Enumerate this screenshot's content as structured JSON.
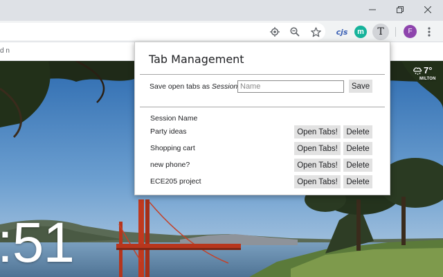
{
  "window": {
    "controls": {
      "minimize_icon": "minimize-icon",
      "restore_icon": "restore-icon",
      "close_icon": "close-icon"
    }
  },
  "toolbar": {
    "icons": [
      "location-icon",
      "zoom-out-icon",
      "bookmark-star-icon",
      "menu-dots-icon"
    ],
    "extensions": {
      "cjs_label": "cjs",
      "m_label": "m",
      "tab_manager_label": "T"
    },
    "profile_initial": "F",
    "bookmark_fragment": "d n"
  },
  "background": {
    "clock_text": ":51",
    "weather": {
      "icon": "cloud-snow-icon",
      "temperature": "7°",
      "location": "MILTON"
    }
  },
  "popup": {
    "title": "Tab Management",
    "save_label_prefix": "Save open tabs as ",
    "save_label_emphasis": "Session",
    "name_placeholder": "Name",
    "save_button": "Save",
    "column_header": "Session Name",
    "sessions": [
      {
        "name": "Party ideas",
        "open_label": "Open Tabs!",
        "delete_label": "Delete"
      },
      {
        "name": "Shopping cart",
        "open_label": "Open Tabs!",
        "delete_label": "Delete"
      },
      {
        "name": "new phone?",
        "open_label": "Open Tabs!",
        "delete_label": "Delete"
      },
      {
        "name": "ECE205 project",
        "open_label": "Open Tabs!",
        "delete_label": "Delete"
      }
    ]
  },
  "colors": {
    "chrome_frame": "#dee1e6",
    "toolbar": "#f1f3f4",
    "avatar": "#8e44ad",
    "extension_m": "#16b39b",
    "button_face": "#e2e2e2"
  }
}
